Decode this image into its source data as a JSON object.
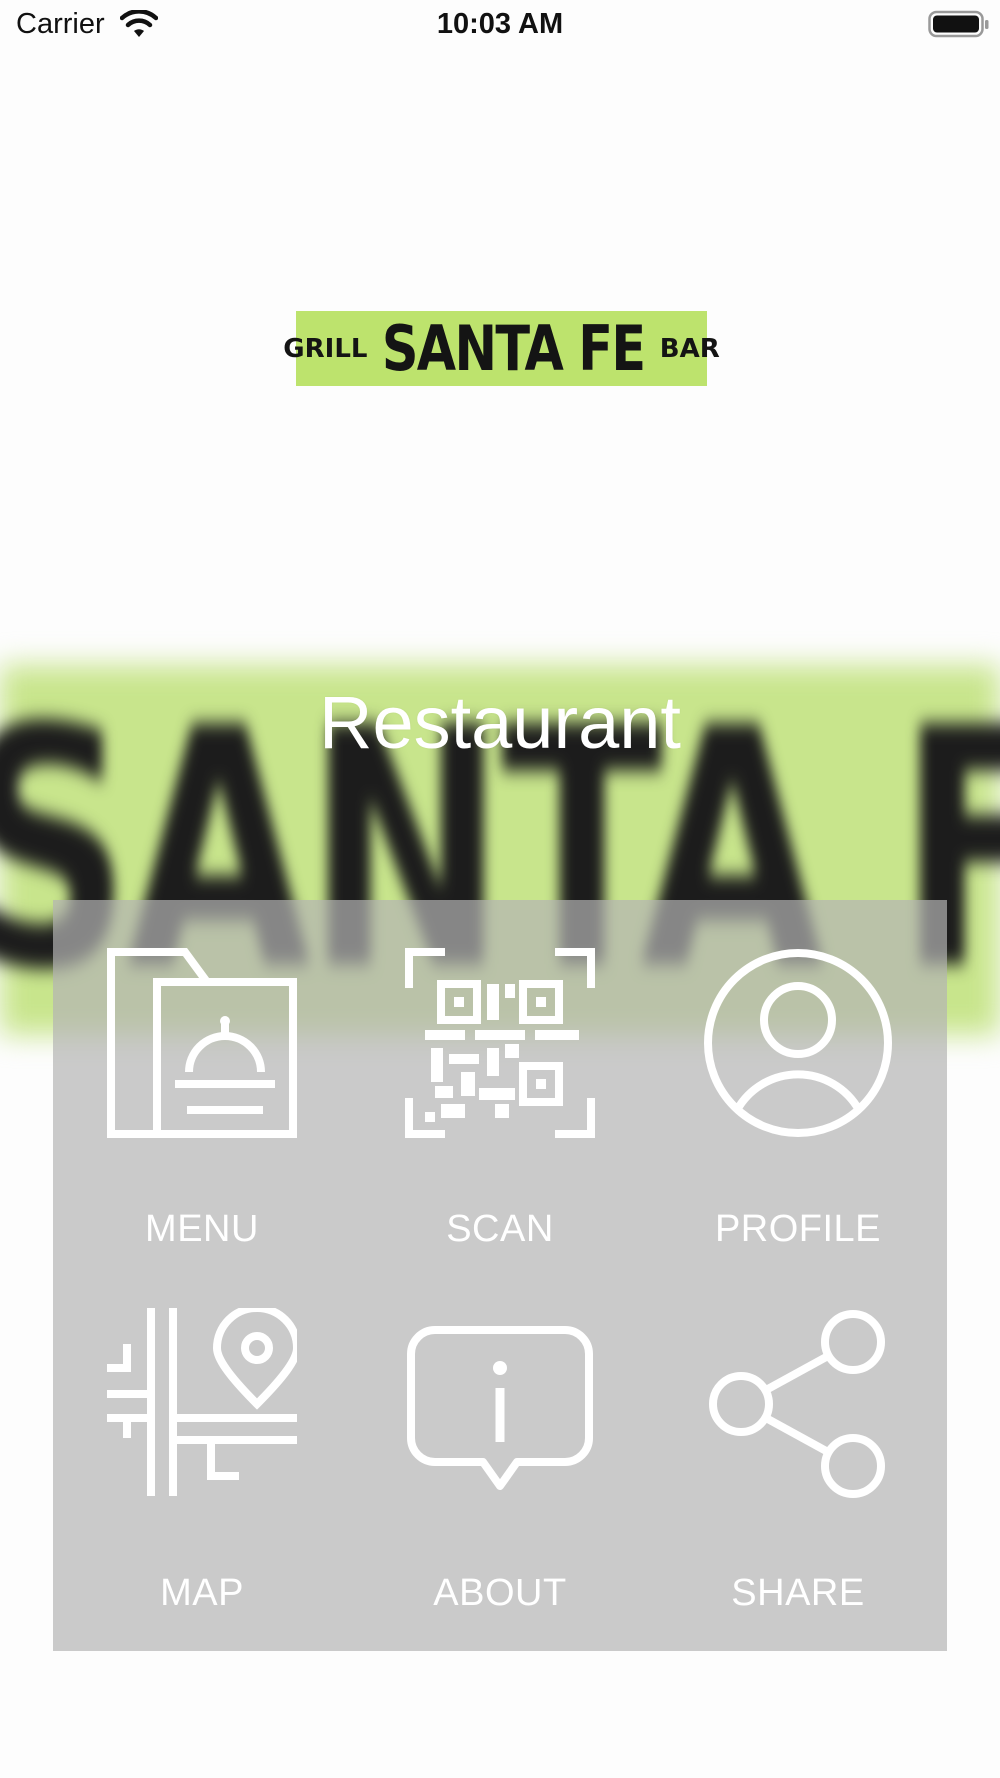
{
  "status_bar": {
    "carrier": "Carrier",
    "time": "10:03 AM"
  },
  "logo": {
    "left": "GRILL",
    "main": "SANTA FE",
    "right": "BAR"
  },
  "title": "Restaurant",
  "tiles": [
    {
      "label": "MENU",
      "icon": "menu-icon"
    },
    {
      "label": "SCAN",
      "icon": "qr-code-icon"
    },
    {
      "label": "PROFILE",
      "icon": "profile-icon"
    },
    {
      "label": "MAP",
      "icon": "map-pin-icon"
    },
    {
      "label": "ABOUT",
      "icon": "info-bubble-icon"
    },
    {
      "label": "SHARE",
      "icon": "share-icon"
    }
  ],
  "colors": {
    "brand_green": "#bde36d",
    "panel": "#c9c9c9",
    "icon": "#ffffff"
  }
}
